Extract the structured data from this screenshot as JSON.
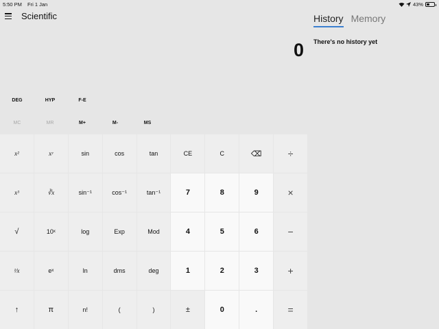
{
  "status": {
    "time": "5:50 PM",
    "date": "Fri 1 Jan",
    "battery": "43%",
    "battery_level": 0.43
  },
  "header": {
    "title": "Scientific"
  },
  "display": {
    "value": "0"
  },
  "panel": {
    "tabs": [
      "History",
      "Memory"
    ],
    "active_tab": "History",
    "empty_message": "There's no history yet"
  },
  "modes": [
    "DEG",
    "HYP",
    "F-E"
  ],
  "memory": [
    {
      "label": "MC",
      "enabled": false
    },
    {
      "label": "MR",
      "enabled": false
    },
    {
      "label": "M+",
      "enabled": true
    },
    {
      "label": "M-",
      "enabled": true
    },
    {
      "label": "MS",
      "enabled": true
    }
  ],
  "keys": [
    [
      "x²",
      "xʸ",
      "sin",
      "cos",
      "tan",
      "CE",
      "C",
      "⌫",
      "÷"
    ],
    [
      "x³",
      "∛x",
      "sin⁻¹",
      "cos⁻¹",
      "tan⁻¹",
      "7",
      "8",
      "9",
      "×"
    ],
    [
      "√",
      "10ˣ",
      "log",
      "Exp",
      "Mod",
      "4",
      "5",
      "6",
      "−"
    ],
    [
      "¹⁄x",
      "eˣ",
      "ln",
      "dms",
      "deg",
      "1",
      "2",
      "3",
      "+"
    ],
    [
      "↑",
      "π",
      "n!",
      "(",
      ")",
      "±",
      "0",
      ".",
      "="
    ]
  ],
  "colors": {
    "background": "#e6e6e6",
    "key": "#eeeeee",
    "number_key": "#f9f9f9",
    "accent": "#3a7fcf"
  }
}
